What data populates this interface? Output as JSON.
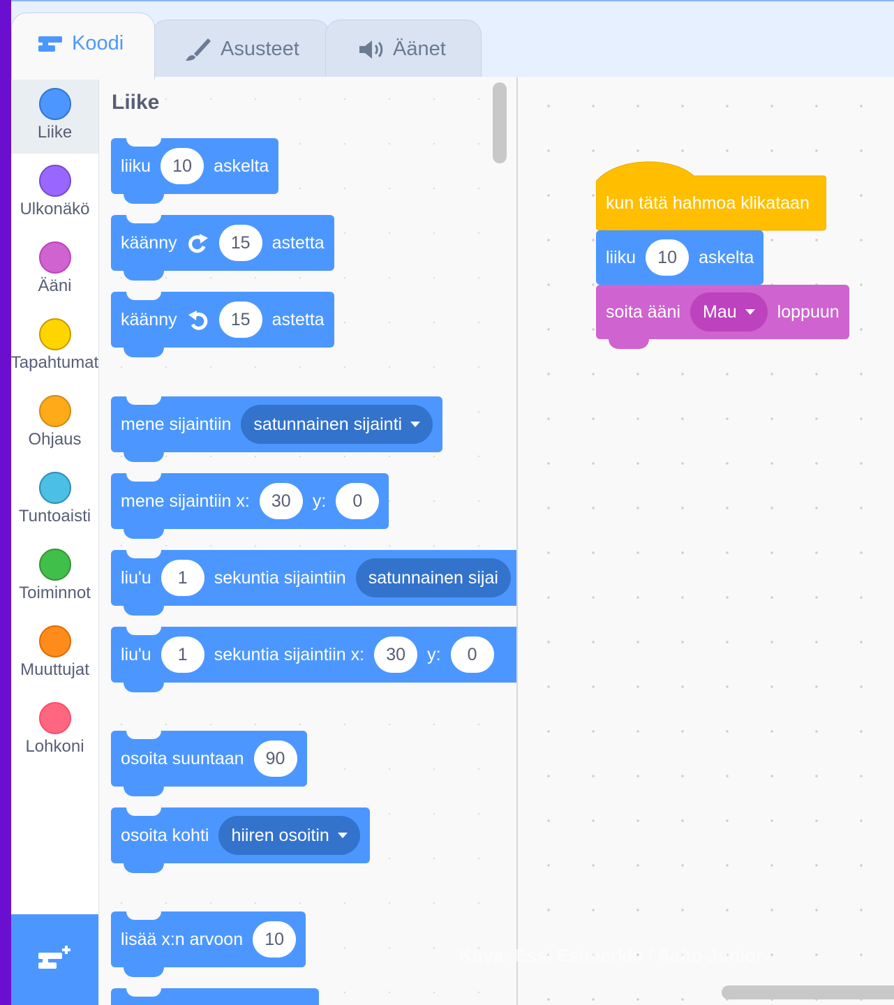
{
  "tabs": [
    {
      "label": "Koodi",
      "icon": "code-icon"
    },
    {
      "label": "Asusteet",
      "icon": "brush-icon"
    },
    {
      "label": "Äänet",
      "icon": "speaker-icon"
    }
  ],
  "categories": [
    {
      "label": "Liike",
      "color": "#4c97ff"
    },
    {
      "label": "Ulkonäkö",
      "color": "#9966ff"
    },
    {
      "label": "Ääni",
      "color": "#cf63cf"
    },
    {
      "label": "Tapahtumat",
      "color": "#ffd500"
    },
    {
      "label": "Ohjaus",
      "color": "#ffab19"
    },
    {
      "label": "Tuntoaisti",
      "color": "#4cbfe6"
    },
    {
      "label": "Toiminnot",
      "color": "#40bf4a"
    },
    {
      "label": "Muuttujat",
      "color": "#ff8c1a"
    },
    {
      "label": "Lohkoni",
      "color": "#ff6680"
    }
  ],
  "palette": {
    "section_title": "Liike",
    "b_move": {
      "t1": "liiku",
      "v": "10",
      "t2": "askelta"
    },
    "b_turn_right": {
      "t1": "käänny",
      "v": "15",
      "t2": "astetta"
    },
    "b_turn_left": {
      "t1": "käänny",
      "v": "15",
      "t2": "astetta"
    },
    "b_goto": {
      "t1": "mene sijaintiin",
      "dd": "satunnainen sijainti"
    },
    "b_goto_xy": {
      "t1": "mene sijaintiin x:",
      "x": "30",
      "t2": "y:",
      "y": "0"
    },
    "b_glide": {
      "t1": "liu'u",
      "v": "1",
      "t2": "sekuntia sijaintiin",
      "dd": "satunnainen sijai"
    },
    "b_glide_xy": {
      "t1": "liu'u",
      "v": "1",
      "t2": "sekuntia sijaintiin x:",
      "x": "30",
      "t3": "y:",
      "y": "0"
    },
    "b_point_dir": {
      "t1": "osoita suuntaan",
      "v": "90"
    },
    "b_point_towards": {
      "t1": "osoita kohti",
      "dd": "hiiren osoitin"
    },
    "b_change_x": {
      "t1": "lisää x:n arvoon",
      "v": "10"
    }
  },
  "workspace": {
    "hat": {
      "label": "kun tätä hahmoa klikataan"
    },
    "move": {
      "t1": "liiku",
      "v": "10",
      "t2": "askelta"
    },
    "sound": {
      "t1": "soita ääni",
      "dd": "Mau",
      "t2": "loppuun"
    }
  },
  "watermark": "Kuva: Essi Esimerkki / Aalto Junior"
}
